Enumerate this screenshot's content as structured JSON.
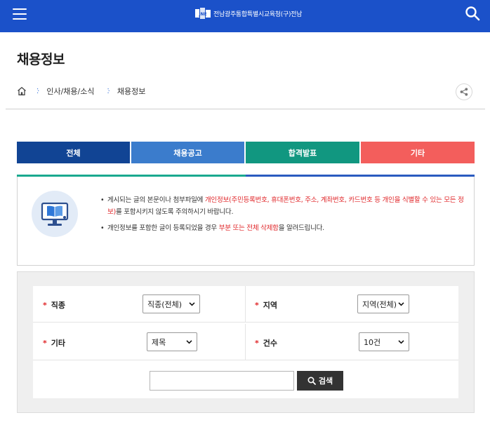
{
  "header": {
    "logo_text": "전남광주통합특별시교육청(구)전남",
    "logo_mark": "JNE",
    "bg_color": "#1b51c9",
    "icons": {
      "menu": "hamburger-icon",
      "search": "search-icon"
    }
  },
  "page": {
    "title": "채용정보"
  },
  "breadcrumb": {
    "items": [
      "인사/채용/소식",
      "채용정보"
    ],
    "home_icon": "home-icon",
    "share_icon": "share-icon"
  },
  "tabs": [
    {
      "label": "전체",
      "color": "#114494",
      "selected": true
    },
    {
      "label": "채용공고",
      "color": "#3b7ccc",
      "selected": false
    },
    {
      "label": "합격발표",
      "color": "#119780",
      "selected": false
    },
    {
      "label": "기타",
      "color": "#f35e5c",
      "selected": false
    }
  ],
  "notice": {
    "icon": "computer-book-icon",
    "bar_colors": [
      "#1aa98f",
      "#2a5bc0"
    ],
    "item1": {
      "t1": "게시되는 글의 본문이나 첨부파일에 ",
      "red": "개인정보(주민등록번호, 휴대폰번호, 주소, 계좌번호, 카드번호 등 개인을 식별할 수 있는 모든 정보)",
      "t2": "를 포함시키지 않도록 주의하시기 바랍니다."
    },
    "item2": {
      "t1": "개인정보를 포함한 글이 등록되었을 경우 ",
      "red": "부분 또는 전체 삭제함",
      "t2": "을 알려드립니다."
    }
  },
  "form": {
    "job": {
      "label": "직종",
      "value": "직종(전체)"
    },
    "region": {
      "label": "지역",
      "value": "지역(전체)"
    },
    "etc": {
      "label": "기타",
      "value": "제목"
    },
    "count": {
      "label": "건수",
      "value": "10건"
    },
    "keyword": {
      "value": "",
      "placeholder": ""
    },
    "search_label": "검색"
  }
}
